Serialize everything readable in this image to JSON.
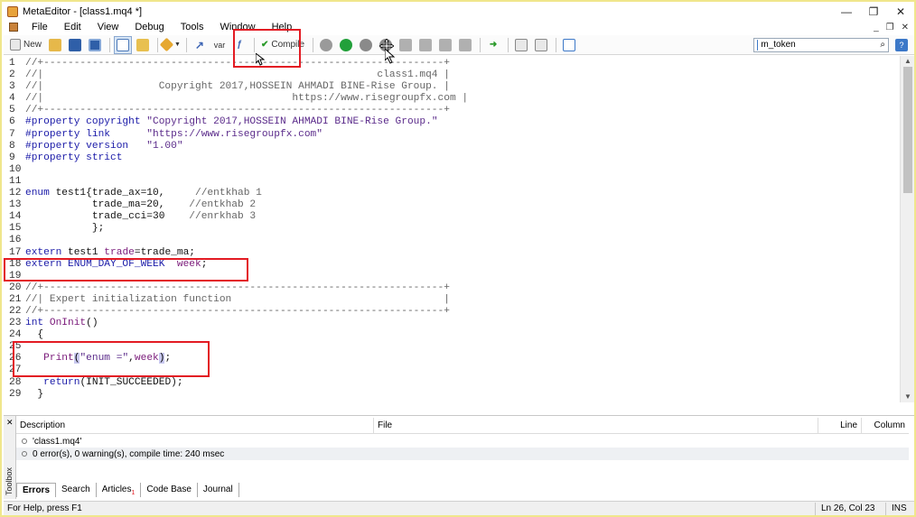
{
  "window": {
    "title": "MetaEditor - [class1.mq4 *]",
    "controls": [
      "—",
      "❐",
      "✕"
    ]
  },
  "menu": {
    "items": [
      "File",
      "Edit",
      "View",
      "Debug",
      "Tools",
      "Window",
      "Help"
    ],
    "mdi_controls": [
      "_",
      "❐",
      "✕"
    ]
  },
  "toolbar": {
    "new_label": "New",
    "compile_label": "Compile",
    "var_label": "var",
    "search_placeholder": "m_token",
    "search_value": "m_token"
  },
  "code": {
    "lines": [
      {
        "n": "1",
        "parts": [
          {
            "t": "//+------------------------------------------------------------------+",
            "c": "comment"
          }
        ]
      },
      {
        "n": "2",
        "parts": [
          {
            "t": "//|                                                       class1.mq4 |",
            "c": "comment"
          }
        ]
      },
      {
        "n": "3",
        "parts": [
          {
            "t": "//|                   Copyright 2017,HOSSEIN AHMADI BINE-Rise Group. |",
            "c": "comment"
          }
        ]
      },
      {
        "n": "4",
        "parts": [
          {
            "t": "//|                                         https://www.risegroupfx.com |",
            "c": "comment"
          }
        ]
      },
      {
        "n": "5",
        "parts": [
          {
            "t": "//+------------------------------------------------------------------+",
            "c": "comment"
          }
        ]
      },
      {
        "n": "6",
        "parts": [
          {
            "t": "#property copyright ",
            "c": "pp"
          },
          {
            "t": "\"Copyright 2017,HOSSEIN AHMADI BINE-Rise Group.\"",
            "c": "dq"
          }
        ]
      },
      {
        "n": "7",
        "parts": [
          {
            "t": "#property link      ",
            "c": "pp"
          },
          {
            "t": "\"https://www.risegroupfx.com\"",
            "c": "dq"
          }
        ]
      },
      {
        "n": "8",
        "parts": [
          {
            "t": "#property version   ",
            "c": "pp"
          },
          {
            "t": "\"1.00\"",
            "c": "dq"
          }
        ]
      },
      {
        "n": "9",
        "parts": [
          {
            "t": "#property strict",
            "c": "pp"
          }
        ]
      },
      {
        "n": "10",
        "parts": [
          {
            "t": "",
            "c": "plain"
          }
        ]
      },
      {
        "n": "11",
        "parts": [
          {
            "t": "",
            "c": "plain"
          }
        ]
      },
      {
        "n": "12",
        "parts": [
          {
            "t": "enum ",
            "c": "kw"
          },
          {
            "t": "test1{trade_ax=10,     ",
            "c": "plain"
          },
          {
            "t": "//entkhab 1",
            "c": "comment"
          }
        ]
      },
      {
        "n": "13",
        "parts": [
          {
            "t": "           trade_ma=20,    ",
            "c": "plain"
          },
          {
            "t": "//entkhab 2",
            "c": "comment"
          }
        ]
      },
      {
        "n": "14",
        "parts": [
          {
            "t": "           trade_cci=30    ",
            "c": "plain"
          },
          {
            "t": "//enrkhab 3",
            "c": "comment"
          }
        ]
      },
      {
        "n": "15",
        "parts": [
          {
            "t": "           };",
            "c": "plain"
          }
        ]
      },
      {
        "n": "16",
        "parts": [
          {
            "t": "",
            "c": "plain"
          }
        ]
      },
      {
        "n": "17",
        "parts": [
          {
            "t": "extern ",
            "c": "kw"
          },
          {
            "t": "test1 ",
            "c": "plain"
          },
          {
            "t": "trade",
            "c": "fn"
          },
          {
            "t": "=trade_ma;",
            "c": "plain"
          }
        ]
      },
      {
        "n": "18",
        "parts": [
          {
            "t": "extern ",
            "c": "kw"
          },
          {
            "t": "ENUM_DAY_OF_WEEK  ",
            "c": "kw"
          },
          {
            "t": "week",
            "c": "fn"
          },
          {
            "t": ";",
            "c": "plain"
          }
        ]
      },
      {
        "n": "19",
        "parts": [
          {
            "t": "",
            "c": "plain"
          }
        ]
      },
      {
        "n": "20",
        "parts": [
          {
            "t": "//+------------------------------------------------------------------+",
            "c": "comment"
          }
        ]
      },
      {
        "n": "21",
        "parts": [
          {
            "t": "//| Expert initialization function                                   |",
            "c": "comment"
          }
        ]
      },
      {
        "n": "22",
        "parts": [
          {
            "t": "//+------------------------------------------------------------------+",
            "c": "comment"
          }
        ]
      },
      {
        "n": "23",
        "parts": [
          {
            "t": "int ",
            "c": "kw"
          },
          {
            "t": "OnInit",
            "c": "fn"
          },
          {
            "t": "()",
            "c": "plain"
          }
        ]
      },
      {
        "n": "24",
        "parts": [
          {
            "t": "  {",
            "c": "plain"
          }
        ]
      },
      {
        "n": "25",
        "parts": [
          {
            "t": "",
            "c": "plain"
          }
        ]
      },
      {
        "n": "26",
        "parts": [
          {
            "t": "   ",
            "c": "plain"
          },
          {
            "t": "Print",
            "c": "fn"
          },
          {
            "t": "(",
            "c": "hl"
          },
          {
            "t": "\"enum =\"",
            "c": "dq"
          },
          {
            "t": ",",
            "c": "plain"
          },
          {
            "t": "week",
            "c": "fn"
          },
          {
            "t": ")",
            "c": "hl"
          },
          {
            "t": ";",
            "c": "plain"
          }
        ]
      },
      {
        "n": "27",
        "parts": [
          {
            "t": "",
            "c": "plain"
          }
        ]
      },
      {
        "n": "28",
        "parts": [
          {
            "t": "   ",
            "c": "plain"
          },
          {
            "t": "return",
            "c": "kw"
          },
          {
            "t": "(INIT_SUCCEEDED);",
            "c": "plain"
          }
        ]
      },
      {
        "n": "29",
        "parts": [
          {
            "t": "  }",
            "c": "plain"
          }
        ]
      }
    ]
  },
  "panel": {
    "toolbox_label": "Toolbox",
    "columns": {
      "description": "Description",
      "file": "File",
      "line": "Line",
      "column": "Column"
    },
    "rows": [
      {
        "description": "'class1.mq4'"
      },
      {
        "description": "0 error(s), 0 warning(s), compile time: 240 msec"
      }
    ],
    "tabs": [
      "Errors",
      "Search",
      "Articles",
      "Code Base",
      "Journal"
    ],
    "articles_badge": "1"
  },
  "status": {
    "help": "For Help, press F1",
    "position": "Ln 26, Col 23",
    "mode": "INS"
  },
  "colors": {
    "highlight_box": "#e31b23",
    "accent": "#3c78c8"
  }
}
